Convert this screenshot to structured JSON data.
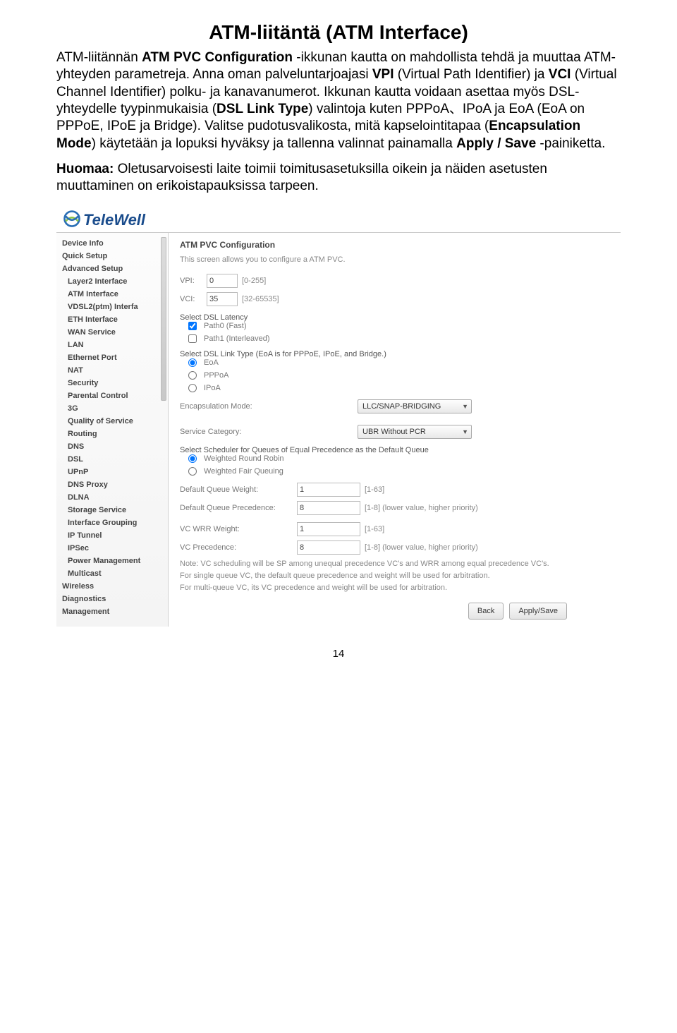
{
  "title": "ATM-liitäntä (ATM Interface)",
  "para1_parts": [
    {
      "t": "ATM-liitännän ",
      "b": false
    },
    {
      "t": "ATM PVC Configuration",
      "b": true
    },
    {
      "t": " -ikkunan kautta on mahdollista tehdä ja muuttaa ATM-yhteyden parametreja. Anna oman palveluntarjoajasi ",
      "b": false
    },
    {
      "t": "VPI",
      "b": true
    },
    {
      "t": " (Virtual Path Identifier) ja ",
      "b": false
    },
    {
      "t": "VCI",
      "b": true
    },
    {
      "t": " (Virtual Channel Identifier) polku- ja kanavanumerot. Ikkunan kautta voidaan asettaa myös DSL-yhteydelle tyypinmukaisia (",
      "b": false
    },
    {
      "t": "DSL Link Type",
      "b": true
    },
    {
      "t": ") valintoja kuten PPPoA、IPoA ja EoA (EoA on PPPoE, IPoE ja Bridge). Valitse pudotusvalikosta, mitä kapselointitapaa (",
      "b": false
    },
    {
      "t": "Encapsulation Mode",
      "b": true
    },
    {
      "t": ") käytetään ja lopuksi hyväksy ja tallenna valinnat painamalla ",
      "b": false
    },
    {
      "t": "Apply / Save",
      "b": true
    },
    {
      "t": " -painiketta.",
      "b": false
    }
  ],
  "para2_parts": [
    {
      "t": "Huomaa:",
      "b": true
    },
    {
      "t": " Oletusarvoisesti laite toimii toimitusasetuksilla oikein ja näiden asetusten muuttaminen on erikoistapauksissa tarpeen.",
      "b": false
    }
  ],
  "logo_text": "TeleWell",
  "sidebar": {
    "items": [
      {
        "label": "Device Info",
        "sub": false
      },
      {
        "label": "Quick Setup",
        "sub": false
      },
      {
        "label": "Advanced Setup",
        "sub": false
      },
      {
        "label": "Layer2 Interface",
        "sub": true
      },
      {
        "label": "ATM Interface",
        "sub": true
      },
      {
        "label": "VDSL2(ptm) Interfa",
        "sub": true
      },
      {
        "label": "ETH Interface",
        "sub": true
      },
      {
        "label": "WAN Service",
        "sub": true
      },
      {
        "label": "LAN",
        "sub": true
      },
      {
        "label": "Ethernet Port",
        "sub": true
      },
      {
        "label": "NAT",
        "sub": true
      },
      {
        "label": "Security",
        "sub": true
      },
      {
        "label": "Parental Control",
        "sub": true
      },
      {
        "label": "3G",
        "sub": true
      },
      {
        "label": "Quality of Service",
        "sub": true
      },
      {
        "label": "Routing",
        "sub": true
      },
      {
        "label": "DNS",
        "sub": true
      },
      {
        "label": "DSL",
        "sub": true
      },
      {
        "label": "UPnP",
        "sub": true
      },
      {
        "label": "DNS Proxy",
        "sub": true
      },
      {
        "label": "DLNA",
        "sub": true
      },
      {
        "label": "Storage Service",
        "sub": true
      },
      {
        "label": "Interface Grouping",
        "sub": true
      },
      {
        "label": "IP Tunnel",
        "sub": true
      },
      {
        "label": "IPSec",
        "sub": true
      },
      {
        "label": "Power Management",
        "sub": true
      },
      {
        "label": "Multicast",
        "sub": true
      },
      {
        "label": "Wireless",
        "sub": false
      },
      {
        "label": "Diagnostics",
        "sub": false
      },
      {
        "label": "Management",
        "sub": false
      }
    ]
  },
  "content": {
    "title": "ATM PVC Configuration",
    "desc": "This screen allows you to configure a ATM PVC.",
    "vpi_label": "VPI:",
    "vpi_value": "0",
    "vpi_hint": "[0-255]",
    "vci_label": "VCI:",
    "vci_value": "35",
    "vci_hint": "[32-65535]",
    "latency_label": "Select DSL Latency",
    "latency_opts": [
      {
        "label": "Path0 (Fast)",
        "checked": true
      },
      {
        "label": "Path1 (Interleaved)",
        "checked": false
      }
    ],
    "link_label": "Select DSL Link Type (EoA is for PPPoE, IPoE, and Bridge.)",
    "link_opts": [
      {
        "label": "EoA",
        "checked": true
      },
      {
        "label": "PPPoA",
        "checked": false
      },
      {
        "label": "IPoA",
        "checked": false
      }
    ],
    "encap_label": "Encapsulation Mode:",
    "encap_value": "LLC/SNAP-BRIDGING",
    "svc_label": "Service Category:",
    "svc_value": "UBR Without PCR",
    "sched_label": "Select Scheduler for Queues of Equal Precedence as the Default Queue",
    "sched_opts": [
      {
        "label": "Weighted Round Robin",
        "checked": true
      },
      {
        "label": "Weighted Fair Queuing",
        "checked": false
      }
    ],
    "dqw_label": "Default Queue Weight:",
    "dqw_value": "1",
    "dqw_hint": "[1-63]",
    "dqp_label": "Default Queue Precedence:",
    "dqp_value": "8",
    "dqp_hint": "[1-8] (lower value, higher priority)",
    "vcw_label": "VC WRR Weight:",
    "vcw_value": "1",
    "vcw_hint": "[1-63]",
    "vcp_label": "VC Precedence:",
    "vcp_value": "8",
    "vcp_hint": "[1-8] (lower value, higher priority)",
    "note1": "Note: VC scheduling will be SP among unequal precedence VC's and WRR among equal precedence VC's.",
    "note2": "For single queue VC, the default queue precedence and weight will be used for arbitration.",
    "note3": "For multi-queue VC, its VC precedence and weight will be used for arbitration.",
    "back_label": "Back",
    "apply_label": "Apply/Save"
  },
  "page_num": "14"
}
